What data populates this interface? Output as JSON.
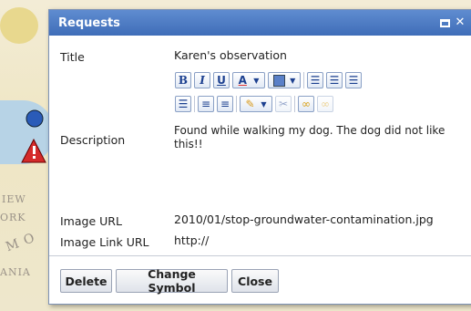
{
  "dialog": {
    "title": "Requests"
  },
  "form": {
    "title_label": "Title",
    "title_value": "Karen's observation",
    "description_label": "Description",
    "description_value": "Found while walking my dog.  The dog did not like this!!",
    "image_url_label": "Image URL",
    "image_url_value": "2010/01/stop-groundwater-contamination.jpg",
    "image_link_url_label": "Image Link URL",
    "image_link_url_value": "http://"
  },
  "buttons": {
    "delete": "Delete",
    "change_symbol": "Change Symbol",
    "close": "Close"
  },
  "map_labels": {
    "new": "IEW",
    "york": "ORK",
    "state_m": "M O",
    "ania": "ANIA"
  },
  "toolbar": {
    "bold": "B",
    "italic": "I",
    "underline": "U",
    "font_color": "A"
  },
  "colors": {
    "titlebar": "#4a78c2",
    "button_border": "#9aa3b5"
  }
}
